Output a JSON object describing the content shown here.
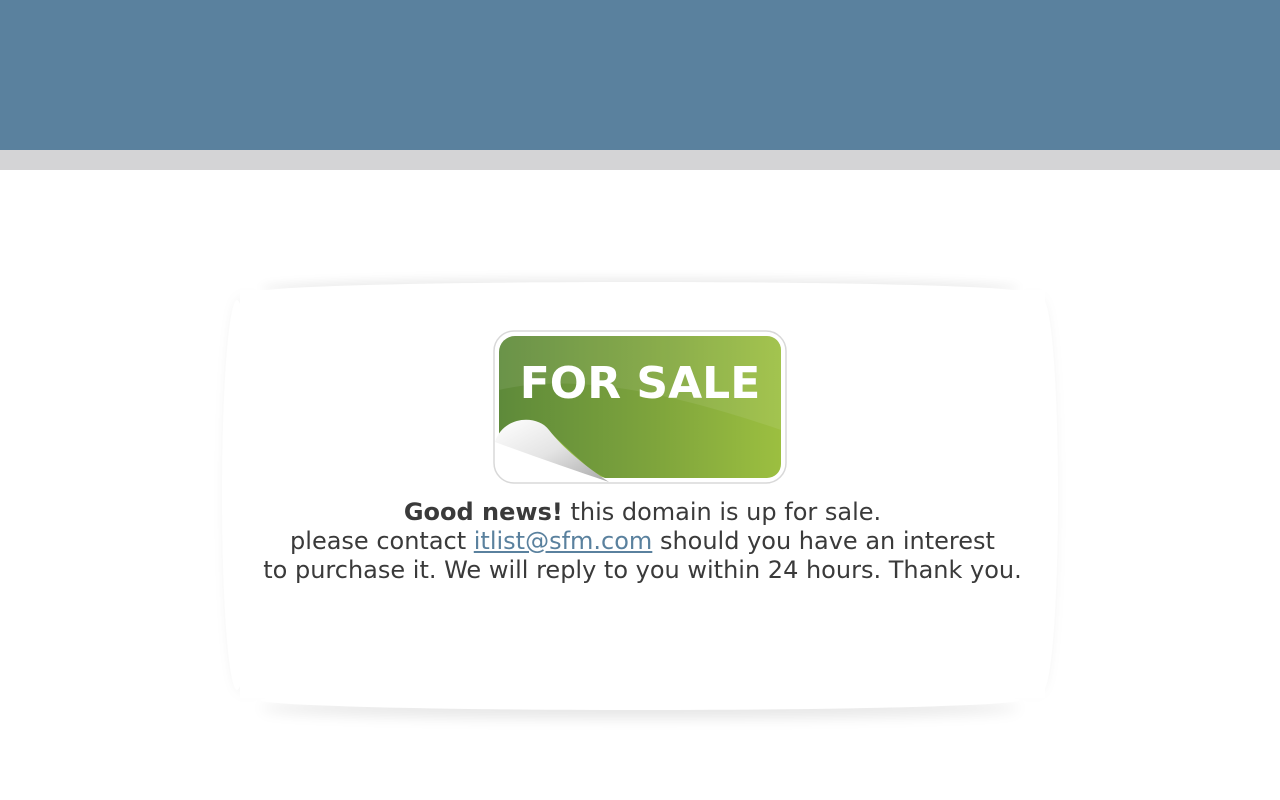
{
  "sticker": {
    "text": "FOR SALE",
    "color_light": "#9bbd3f",
    "color_dark": "#5f8a38"
  },
  "message": {
    "headline_bold": "Good news!",
    "headline_rest": " this domain is up for sale.",
    "line2_prefix": "please contact ",
    "email": "itlist@sfm.com",
    "line2_suffix": " should you have an interest",
    "line3": "to purchase it. We will reply to you within 24 hours. Thank you."
  },
  "colors": {
    "header": "#5a819e",
    "stripe": "#d4d4d6",
    "link": "#5a819e",
    "text": "#3a3a3a"
  }
}
